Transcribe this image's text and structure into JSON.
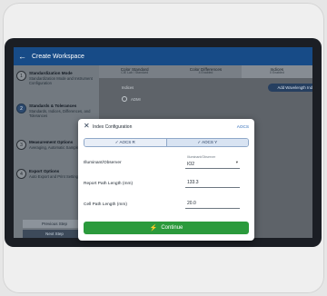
{
  "app": {
    "title": "Create Workspace"
  },
  "sidebar": {
    "steps": [
      {
        "num": "1",
        "title": "Standardization Mode",
        "sub": "Standardization Mode and Instrument Configuration"
      },
      {
        "num": "2",
        "title": "Standards & Tolerances",
        "sub": "Standards, Indices, Differences, and Tolerances"
      },
      {
        "num": "3",
        "title": "Measurement Options",
        "sub": "Averaging, Automatic Sample Naming"
      },
      {
        "num": "4",
        "title": "Export Options",
        "sub": "Auto Export and Print Settings"
      }
    ],
    "prev": "Previous Step",
    "next": "Next Step"
  },
  "tabs": [
    {
      "label": "Color Standard",
      "sub": "CIE Lab / Standard"
    },
    {
      "label": "Color Differences",
      "sub": "4 Enabled"
    },
    {
      "label": "Indices",
      "sub": "0 Enabled"
    }
  ],
  "main": {
    "indices_label": "Indices",
    "add_wavelength": "Add Wavelength Index",
    "radio_label": "ADMI"
  },
  "modal": {
    "title": "Index Configuration",
    "link": "AOCS",
    "seg_a": "✓ AOCS R",
    "seg_b": "✓ AOCS Y",
    "illum_label": "Illuminant/Observer",
    "illum_caption": "Illuminant/Observer",
    "illum_value": "IO2",
    "report_label": "Report Path Length (mm)",
    "report_value": "133.3",
    "cell_label": "Cell Path Length (mm)",
    "cell_value": "20.0",
    "continue": "Continue"
  }
}
